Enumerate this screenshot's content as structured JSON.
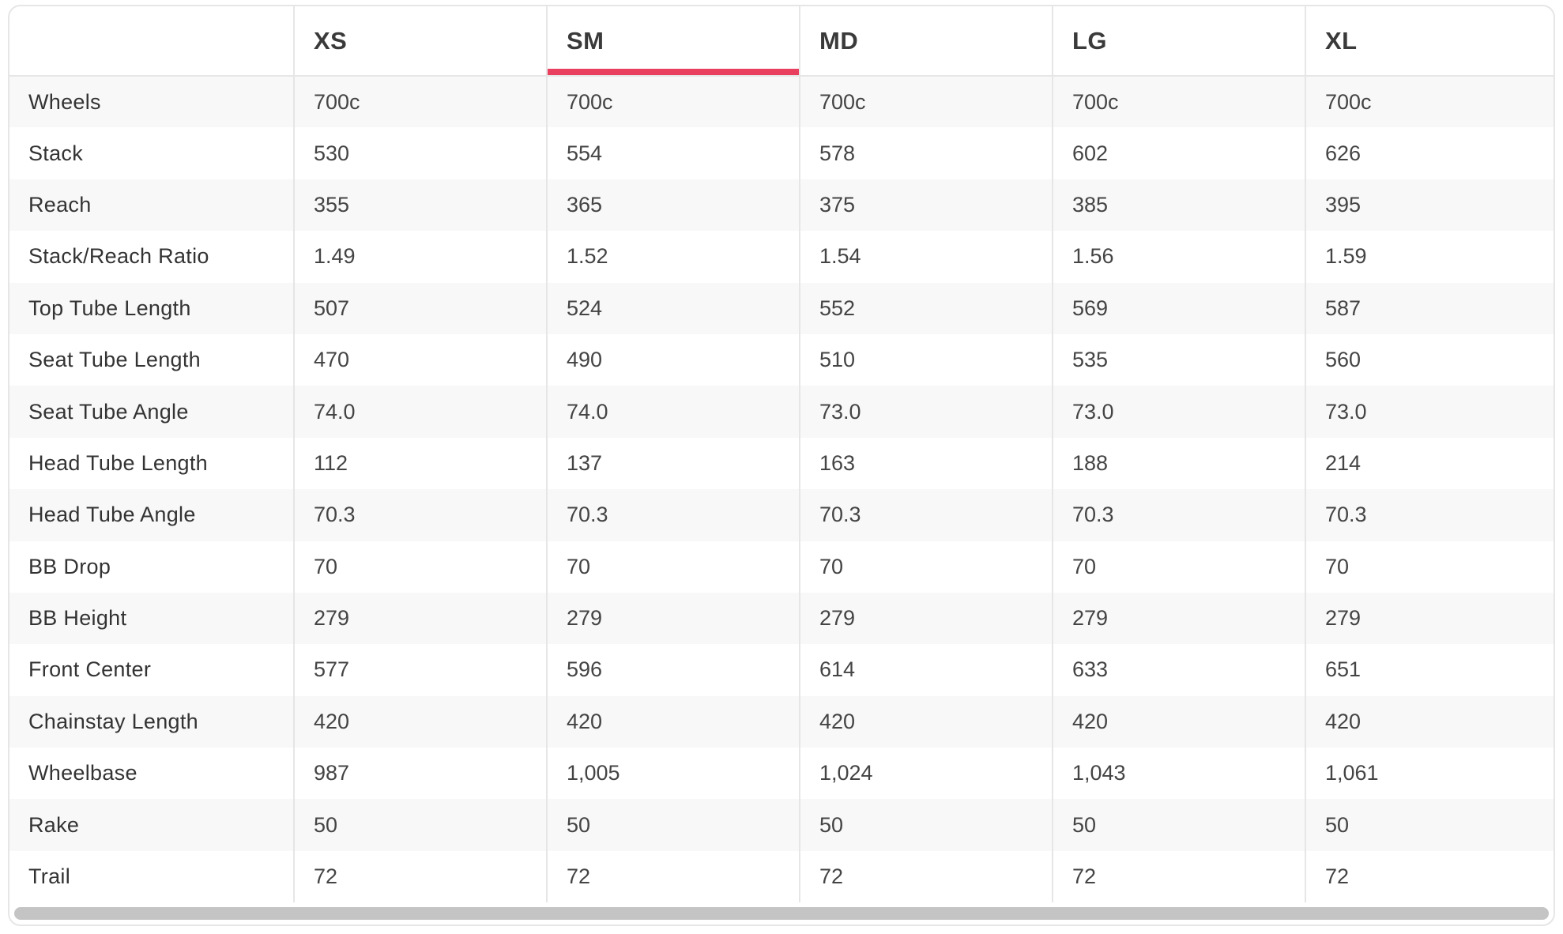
{
  "theme": {
    "accent": "#e8405e"
  },
  "table": {
    "corner_label": "",
    "selected_size": "SM",
    "sizes": [
      "XS",
      "SM",
      "MD",
      "LG",
      "XL"
    ],
    "rows": [
      {
        "label": "Wheels",
        "values": [
          "700c",
          "700c",
          "700c",
          "700c",
          "700c"
        ]
      },
      {
        "label": "Stack",
        "values": [
          "530",
          "554",
          "578",
          "602",
          "626"
        ]
      },
      {
        "label": "Reach",
        "values": [
          "355",
          "365",
          "375",
          "385",
          "395"
        ]
      },
      {
        "label": "Stack/Reach Ratio",
        "values": [
          "1.49",
          "1.52",
          "1.54",
          "1.56",
          "1.59"
        ]
      },
      {
        "label": "Top Tube Length",
        "values": [
          "507",
          "524",
          "552",
          "569",
          "587"
        ]
      },
      {
        "label": "Seat Tube Length",
        "values": [
          "470",
          "490",
          "510",
          "535",
          "560"
        ]
      },
      {
        "label": "Seat Tube Angle",
        "values": [
          "74.0",
          "74.0",
          "73.0",
          "73.0",
          "73.0"
        ]
      },
      {
        "label": "Head Tube Length",
        "values": [
          "112",
          "137",
          "163",
          "188",
          "214"
        ]
      },
      {
        "label": "Head Tube Angle",
        "values": [
          "70.3",
          "70.3",
          "70.3",
          "70.3",
          "70.3"
        ]
      },
      {
        "label": "BB Drop",
        "values": [
          "70",
          "70",
          "70",
          "70",
          "70"
        ]
      },
      {
        "label": "BB Height",
        "values": [
          "279",
          "279",
          "279",
          "279",
          "279"
        ]
      },
      {
        "label": "Front Center",
        "values": [
          "577",
          "596",
          "614",
          "633",
          "651"
        ]
      },
      {
        "label": "Chainstay Length",
        "values": [
          "420",
          "420",
          "420",
          "420",
          "420"
        ]
      },
      {
        "label": "Wheelbase",
        "values": [
          "987",
          "1,005",
          "1,024",
          "1,043",
          "1,061"
        ]
      },
      {
        "label": "Rake",
        "values": [
          "50",
          "50",
          "50",
          "50",
          "50"
        ]
      },
      {
        "label": "Trail",
        "values": [
          "72",
          "72",
          "72",
          "72",
          "72"
        ]
      }
    ]
  },
  "scrollbar": {
    "thumb_fraction": 1.0
  }
}
